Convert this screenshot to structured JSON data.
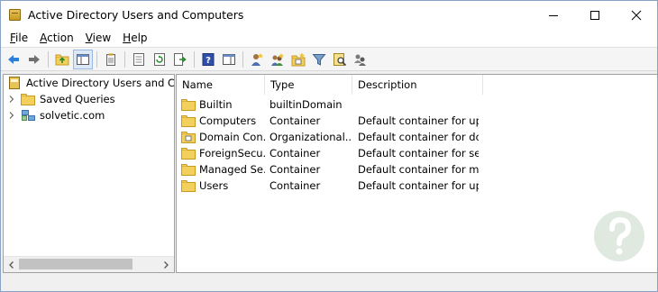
{
  "window": {
    "title": "Active Directory Users and Computers",
    "controls": {
      "minimize": "minimize",
      "maximize": "maximize",
      "close": "close"
    }
  },
  "menu": [
    {
      "mnemonic": "F",
      "rest": "ile"
    },
    {
      "mnemonic": "A",
      "rest": "ction"
    },
    {
      "mnemonic": "V",
      "rest": "iew"
    },
    {
      "mnemonic": "H",
      "rest": "elp"
    }
  ],
  "toolbar": {
    "icons": [
      "back-arrow-icon",
      "forward-arrow-icon",
      "up-folder-icon",
      "show-hide-console-tree-icon",
      "copy-icon",
      "properties-icon",
      "refresh-icon",
      "export-list-icon",
      "help-icon",
      "show-hide-action-pane-icon",
      "new-user-icon",
      "new-group-icon",
      "new-ou-icon",
      "filter-icon",
      "find-icon",
      "add-to-group-icon"
    ]
  },
  "tree": {
    "root_label": "Active Directory Users and Com",
    "items": [
      {
        "label": "Saved Queries",
        "icon": "folder-icon"
      },
      {
        "label": "solvetic.com",
        "icon": "domain-icon"
      }
    ]
  },
  "list": {
    "columns": [
      "Name",
      "Type",
      "Description"
    ],
    "rows": [
      {
        "name": "Builtin",
        "type": "builtinDomain",
        "description": "",
        "icon": "folder-icon"
      },
      {
        "name": "Computers",
        "type": "Container",
        "description": "Default container for up...",
        "icon": "folder-icon"
      },
      {
        "name": "Domain Con...",
        "type": "Organizational...",
        "description": "Default container for do...",
        "icon": "ou-icon"
      },
      {
        "name": "ForeignSecu...",
        "type": "Container",
        "description": "Default container for sec...",
        "icon": "folder-icon"
      },
      {
        "name": "Managed Se...",
        "type": "Container",
        "description": "Default container for ma...",
        "icon": "folder-icon"
      },
      {
        "name": "Users",
        "type": "Container",
        "description": "Default container for up...",
        "icon": "folder-icon"
      }
    ]
  },
  "colors": {
    "folder": "#f3cf5c",
    "folder_edge": "#c79a22",
    "selection_border": "#99b8de",
    "watermark": "#c4d7c4"
  }
}
